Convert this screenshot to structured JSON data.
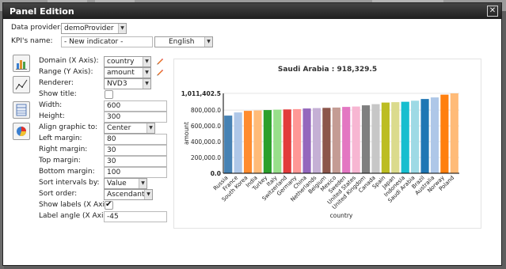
{
  "dialog": {
    "title": "Panel Edition"
  },
  "form": {
    "data_provider": {
      "label": "Data provider:",
      "value": "demoProvider"
    },
    "kpi_name": {
      "label": "KPI's name:",
      "value": "- New indicator -",
      "language": "English"
    },
    "domain": {
      "label": "Domain (X Axis):",
      "value": "country"
    },
    "range": {
      "label": "Range (Y Axis):",
      "value": "amount"
    },
    "renderer": {
      "label": "Renderer:",
      "value": "NVD3"
    },
    "show_title": {
      "label": "Show title:",
      "checked": false
    },
    "width": {
      "label": "Width:",
      "value": "600"
    },
    "height": {
      "label": "Height:",
      "value": "300"
    },
    "align": {
      "label": "Align graphic to:",
      "value": "Center"
    },
    "left_margin": {
      "label": "Left margin:",
      "value": "80"
    },
    "right_margin": {
      "label": "Right margin:",
      "value": "30"
    },
    "top_margin": {
      "label": "Top margin:",
      "value": "30"
    },
    "bottom_margin": {
      "label": "Bottom margin:",
      "value": "100"
    },
    "sort_intervals": {
      "label": "Sort intervals by:",
      "value": "Value"
    },
    "sort_order": {
      "label": "Sort order:",
      "value": "Ascendant"
    },
    "show_labels": {
      "label": "Show labels (X Axis):",
      "checked": true
    },
    "label_angle": {
      "label": "Label angle (X Axis):",
      "value": "-45"
    }
  },
  "toolbar_icons": [
    "bar-chart-icon",
    "line-chart-icon",
    "table-icon",
    "pie-chart-icon"
  ],
  "chart_data": {
    "type": "bar",
    "title": "Saudi Arabia : 918,329.5",
    "xlabel": "country",
    "ylabel": "amount",
    "ylim": [
      0,
      1011402.5
    ],
    "yticks": [
      "0.0",
      "200,000.0",
      "400,000.0",
      "600,000.0",
      "800,000.0",
      "1,011,402.5"
    ],
    "categories": [
      "Russia",
      "France",
      "South Korea",
      "India",
      "Turkey",
      "Italy",
      "Switzerland",
      "Germany",
      "China",
      "Netherlands",
      "Belgium",
      "Mexico",
      "Sweden",
      "United States",
      "United Kingdom",
      "Canada",
      "Spain",
      "Japan",
      "Indonesia",
      "Saudi Arabia",
      "Brazil",
      "Australia",
      "Norway",
      "Poland"
    ],
    "values": [
      730000,
      770000,
      790000,
      795000,
      800000,
      805000,
      808000,
      812000,
      820000,
      825000,
      828000,
      832000,
      840000,
      845000,
      860000,
      875000,
      895000,
      900000,
      905000,
      918329.5,
      940000,
      960000,
      995000,
      1011402.5
    ],
    "colors": [
      "#4682b4",
      "#aec7e8",
      "#ff8c2f",
      "#ffbb78",
      "#2ca02c",
      "#98df8a",
      "#e23b3b",
      "#ff9896",
      "#9467bd",
      "#c5b0d5",
      "#8c564b",
      "#c49c94",
      "#e377c2",
      "#f7b6d2",
      "#7f7f7f",
      "#c7c7c7",
      "#bcbd22",
      "#dbdb8d",
      "#17becf",
      "#9edae5",
      "#1f77b4",
      "#aec7e8",
      "#ff7f0e",
      "#ffbb78"
    ]
  }
}
